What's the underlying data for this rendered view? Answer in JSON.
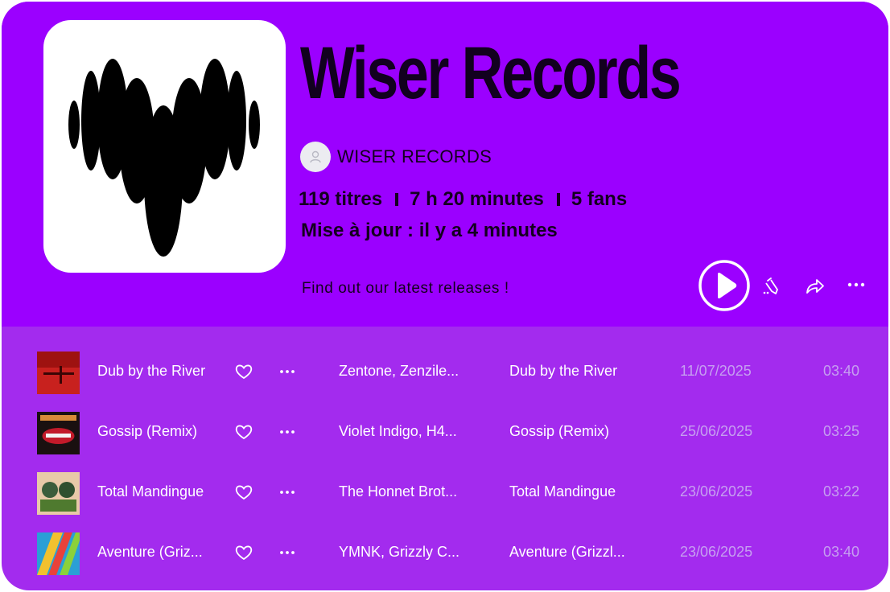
{
  "playlist": {
    "title": "Wiser Records",
    "owner": "WISER RECORDS",
    "tracks_count": "119 titres",
    "duration": "7 h 20 minutes",
    "fans": "5 fans",
    "updated": "Mise à jour : il y a 4 minutes",
    "description": "Find out our latest releases !"
  },
  "colors": {
    "header_bg": "#9b00ff",
    "list_bg": "#a32bee",
    "text_dark": "#14001f",
    "muted": "#c69ff0"
  },
  "actions": {
    "play": "play-icon",
    "edit": "pencil-icon",
    "share": "share-icon",
    "more": "more-horizontal-icon"
  },
  "tracks": [
    {
      "title": "Dub by the River",
      "artist": "Zentone, Zenzile...",
      "album": "Dub by the River",
      "date": "11/07/2025",
      "duration": "03:40"
    },
    {
      "title": "Gossip (Remix)",
      "artist": "Violet Indigo, H4...",
      "album": "Gossip (Remix)",
      "date": "25/06/2025",
      "duration": "03:25"
    },
    {
      "title": "Total Mandingue",
      "artist": "The Honnet Brot...",
      "album": "Total Mandingue",
      "date": "23/06/2025",
      "duration": "03:22"
    },
    {
      "title": "Aventure (Griz...",
      "artist": "YMNK, Grizzly C...",
      "album": "Aventure (Grizzl...",
      "date": "23/06/2025",
      "duration": "03:40"
    }
  ]
}
